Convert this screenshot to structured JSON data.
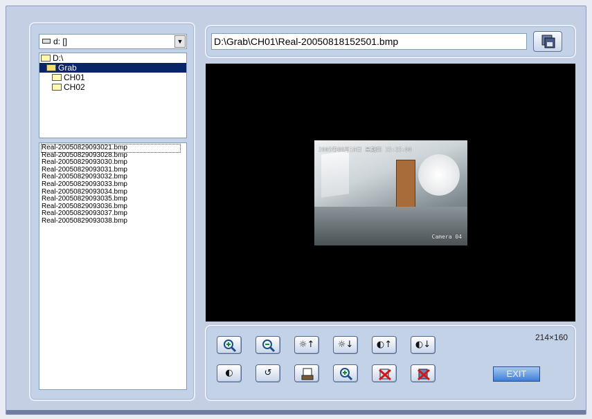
{
  "drive_select": {
    "value": "d: []"
  },
  "tree": [
    {
      "label": "D:\\",
      "indent": 0,
      "selected": false
    },
    {
      "label": "Grab",
      "indent": 1,
      "selected": true
    },
    {
      "label": "CH01",
      "indent": 2,
      "selected": false
    },
    {
      "label": "CH02",
      "indent": 2,
      "selected": false
    }
  ],
  "files": [
    "Real-20050829093021.bmp",
    "Real-20050829093028.bmp",
    "Real-20050829093030.bmp",
    "Real-20050829093031.bmp",
    "Real-20050829093032.bmp",
    "Real-20050829093033.bmp",
    "Real-20050829093034.bmp",
    "Real-20050829093035.bmp",
    "Real-20050829093036.bmp",
    "Real-20050829093037.bmp",
    "Real-20050829093038.bmp"
  ],
  "path_field": {
    "value": "D:\\Grab\\CH01\\Real-20050818152501.bmp"
  },
  "preview": {
    "osd_datetime": "2005年08月18日 星期四 15:25:00",
    "osd_camera": "Camera 04"
  },
  "resolution": "214×160",
  "exit_label": "EXIT",
  "toolbar_row1": [
    {
      "name": "zoom-in-button",
      "icon": "magnifier-plus-icon",
      "glyph": ""
    },
    {
      "name": "zoom-out-button",
      "icon": "magnifier-minus-icon",
      "glyph": ""
    },
    {
      "name": "brightness-up-button",
      "icon": "brightness-up-icon",
      "glyph": "☼↑"
    },
    {
      "name": "brightness-down-button",
      "icon": "brightness-down-icon",
      "glyph": "☼↓"
    },
    {
      "name": "contrast-up-button",
      "icon": "contrast-up-icon",
      "glyph": "◐↑"
    },
    {
      "name": "contrast-down-button",
      "icon": "contrast-down-icon",
      "glyph": "◐↓"
    }
  ],
  "toolbar_row2": [
    {
      "name": "contrast-reset-button",
      "icon": "contrast-icon",
      "glyph": "◐"
    },
    {
      "name": "reset-button",
      "icon": "reset-icon",
      "glyph": "↺"
    },
    {
      "name": "print-button",
      "icon": "print-icon",
      "glyph": ""
    },
    {
      "name": "fit-zoom-button",
      "icon": "magnifier-icon",
      "glyph": ""
    },
    {
      "name": "delete-button",
      "icon": "delete-icon",
      "glyph": ""
    },
    {
      "name": "delete-all-button",
      "icon": "delete-all-icon",
      "glyph": ""
    }
  ]
}
